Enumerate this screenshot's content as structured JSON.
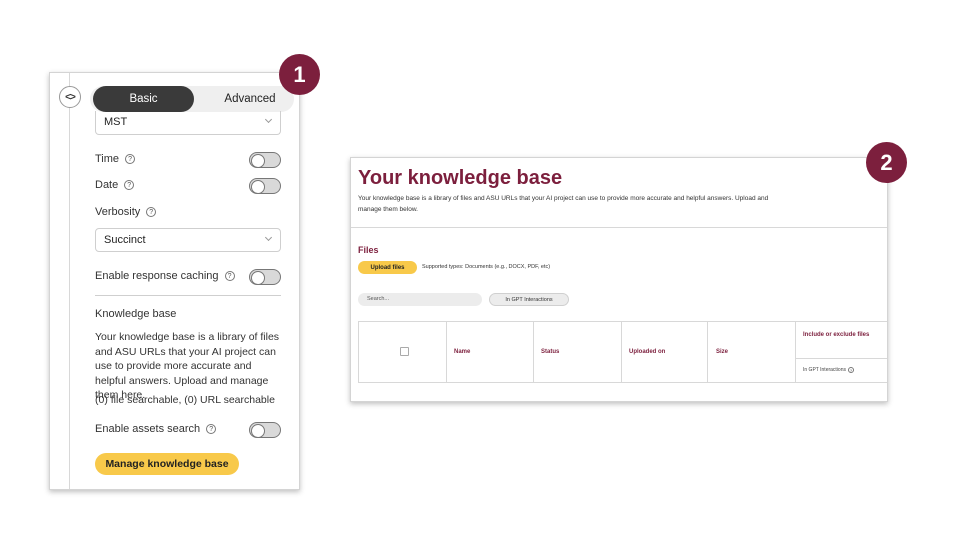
{
  "panel1": {
    "badge": "1",
    "collapse_icon": "code-chevrons-icon",
    "tabs": {
      "basic": "Basic",
      "advanced": "Advanced"
    },
    "timezone_value": "MST",
    "time_label": "Time",
    "date_label": "Date",
    "verbosity_label": "Verbosity",
    "verbosity_value": "Succinct",
    "caching_label": "Enable response caching",
    "kb_heading": "Knowledge base",
    "kb_description": "Your knowledge base is a library of files and ASU URLs that your AI project can use to provide more accurate and helpful answers. Upload and manage them here.",
    "kb_count": "(0) file searchable, (0) URL searchable",
    "assets_label": "Enable assets search",
    "manage_button": "Manage knowledge base",
    "help_glyph": "?"
  },
  "panel2": {
    "badge": "2",
    "title": "Your knowledge base",
    "description": "Your knowledge base is a library of files and ASU URLs that your AI project can use to provide more accurate and helpful answers. Upload and manage them below.",
    "files_heading": "Files",
    "upload_button": "Upload files",
    "supported_types": "Supported types: Documents (e.g., DOCX, PDF, etc)",
    "search_placeholder": "Search...",
    "filter_label": "In GPT Interactions",
    "table": {
      "headers": [
        "Name",
        "Status",
        "Uploaded on",
        "Size",
        "Include or exclude files"
      ],
      "subheader": "In GPT Interactions"
    }
  },
  "colors": {
    "accent": "#7c1f3d",
    "button_yellow": "#f8c94a"
  }
}
